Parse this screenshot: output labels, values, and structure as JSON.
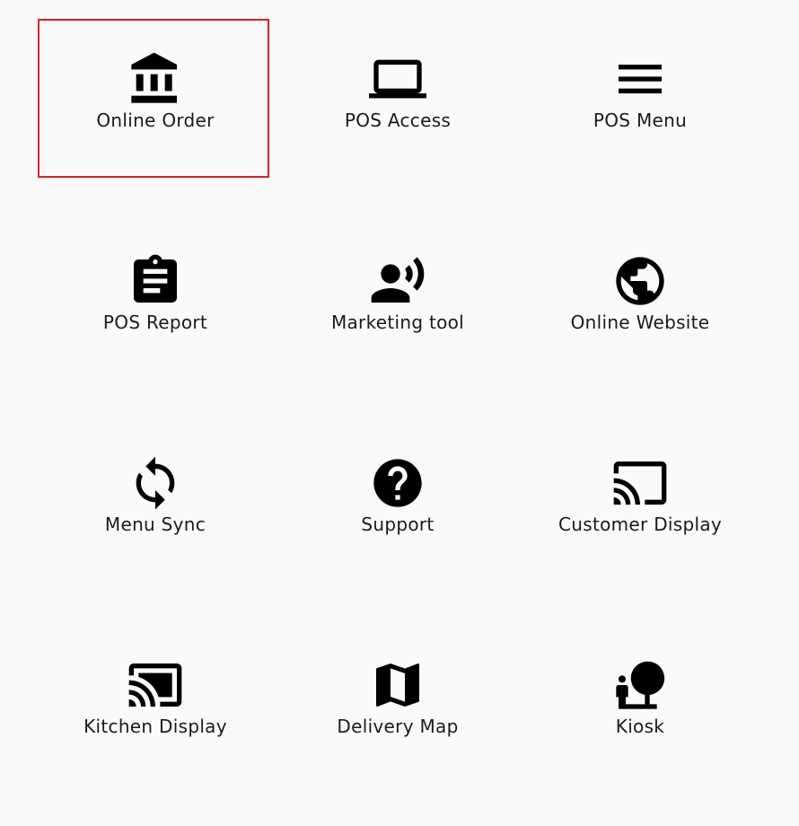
{
  "selected_color": "#e02020",
  "tiles": [
    {
      "label": "Online Order",
      "icon": "bank-icon",
      "selected": true
    },
    {
      "label": "POS Access",
      "icon": "laptop-icon",
      "selected": false
    },
    {
      "label": "POS Menu",
      "icon": "menu-icon",
      "selected": false
    },
    {
      "label": "POS Report",
      "icon": "clipboard-icon",
      "selected": false
    },
    {
      "label": "Marketing tool",
      "icon": "record-voice-icon",
      "selected": false
    },
    {
      "label": "Online Website",
      "icon": "globe-icon",
      "selected": false
    },
    {
      "label": "Menu Sync",
      "icon": "sync-icon",
      "selected": false
    },
    {
      "label": "Support",
      "icon": "help-icon",
      "selected": false
    },
    {
      "label": "Customer Display",
      "icon": "cast-icon",
      "selected": false
    },
    {
      "label": "Kitchen Display",
      "icon": "cast-connected-icon",
      "selected": false
    },
    {
      "label": "Delivery Map",
      "icon": "map-icon",
      "selected": false
    },
    {
      "label": "Kiosk",
      "icon": "nature-people-icon",
      "selected": false
    }
  ]
}
